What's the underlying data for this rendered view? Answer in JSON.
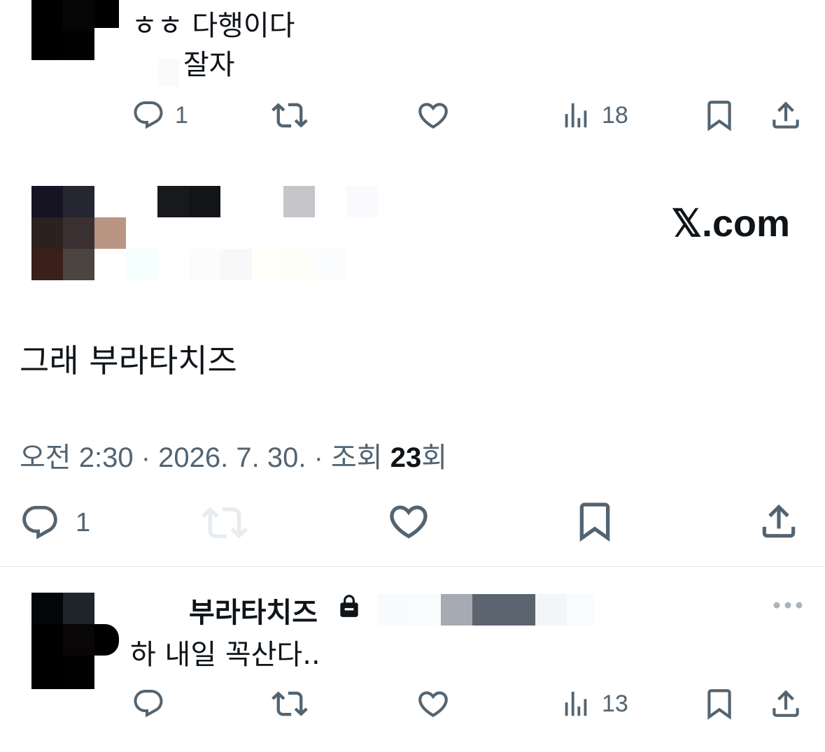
{
  "reply_top": {
    "line1": "ㅎㅎ 다행이다",
    "line2": "잘자",
    "replies": "1",
    "views": "18"
  },
  "main_tweet": {
    "source": "𝕏.com",
    "text": "그래 부라타치즈",
    "time": "오전 2:30",
    "date": "2026. 7. 30.",
    "views_label": "조회",
    "views_count": "23",
    "views_unit": "회",
    "replies": "1"
  },
  "reply_bottom": {
    "display_name": "부라타치즈",
    "text": "하 내일 꼭산다..",
    "views": "13"
  },
  "icons": {
    "reply": "reply-icon",
    "retweet": "retweet-icon",
    "like": "heart-icon",
    "views": "views-chart-icon",
    "bookmark": "bookmark-icon",
    "share": "share-icon",
    "lock": "lock-icon",
    "more": "more-icon"
  },
  "colors": {
    "text": "#0f1419",
    "secondary": "#536471",
    "disabled": "#cfd9de",
    "divider": "#e1e6ea"
  }
}
